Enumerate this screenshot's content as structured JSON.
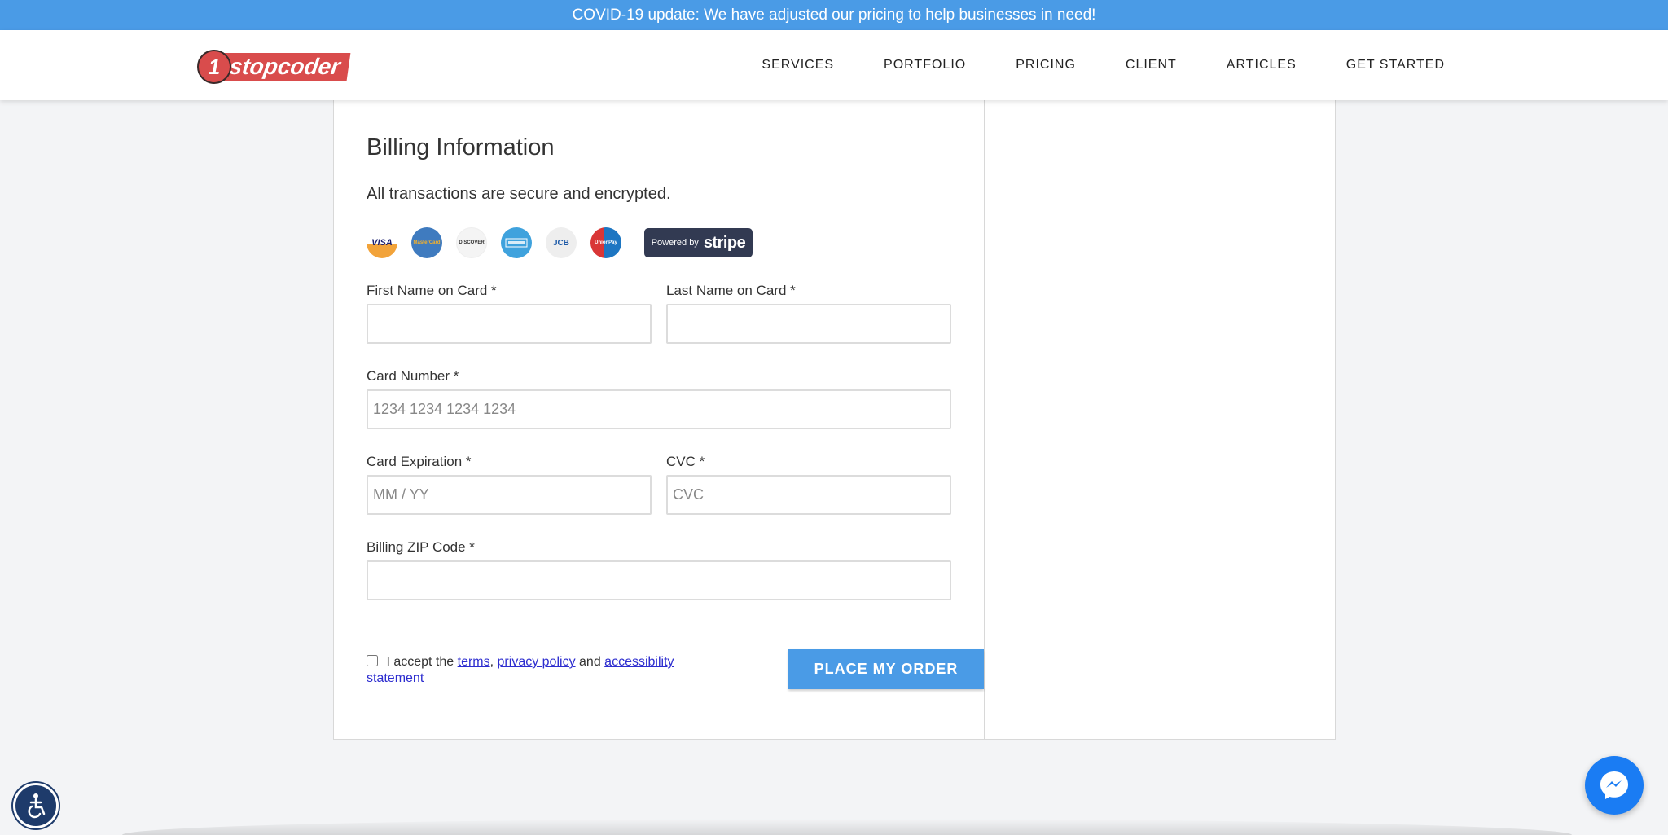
{
  "banner": {
    "text": "COVID-19 update: We have adjusted our pricing to help businesses in need!"
  },
  "header": {
    "logo": {
      "number": "1",
      "text": "stopcoder"
    },
    "nav": [
      "SERVICES",
      "PORTFOLIO",
      "PRICING",
      "CLIENT",
      "ARTICLES",
      "GET STARTED"
    ]
  },
  "billing": {
    "title": "Billing Information",
    "subtitle": "All transactions are secure and encrypted.",
    "payment_icons": {
      "visa": "VISA",
      "mastercard": "MasterCard",
      "discover": "DISCOVER",
      "amex": "AMERICAN EXPRESS",
      "jcb": "JCB",
      "unionpay": "UnionPay"
    },
    "stripe": {
      "prefix": "Powered by",
      "brand": "stripe"
    },
    "fields": {
      "first_name": {
        "label": "First Name on Card *",
        "value": "",
        "placeholder": ""
      },
      "last_name": {
        "label": "Last Name on Card *",
        "value": "",
        "placeholder": ""
      },
      "card_number": {
        "label": "Card Number *",
        "value": "",
        "placeholder": "1234 1234 1234 1234"
      },
      "expiration": {
        "label": "Card Expiration *",
        "value": "",
        "placeholder": "MM / YY"
      },
      "cvc": {
        "label": "CVC *",
        "value": "",
        "placeholder": "CVC"
      },
      "zip": {
        "label": "Billing ZIP Code *",
        "value": "",
        "placeholder": ""
      }
    },
    "terms": {
      "prefix": "I accept the",
      "terms_link": "terms",
      "comma": ",",
      "privacy_link": "privacy policy",
      "and": "and",
      "accessibility_link": "accessibility statement"
    },
    "submit_label": "PLACE MY ORDER"
  },
  "colors": {
    "accent": "#4a9be6",
    "logo_red": "#d94c4c",
    "stripe_badge": "#323a52",
    "messenger": "#1a7cf3",
    "accessibility": "#1e3b6b"
  },
  "icons": {
    "accessibility": "accessibility-icon",
    "messenger": "messenger-icon"
  }
}
